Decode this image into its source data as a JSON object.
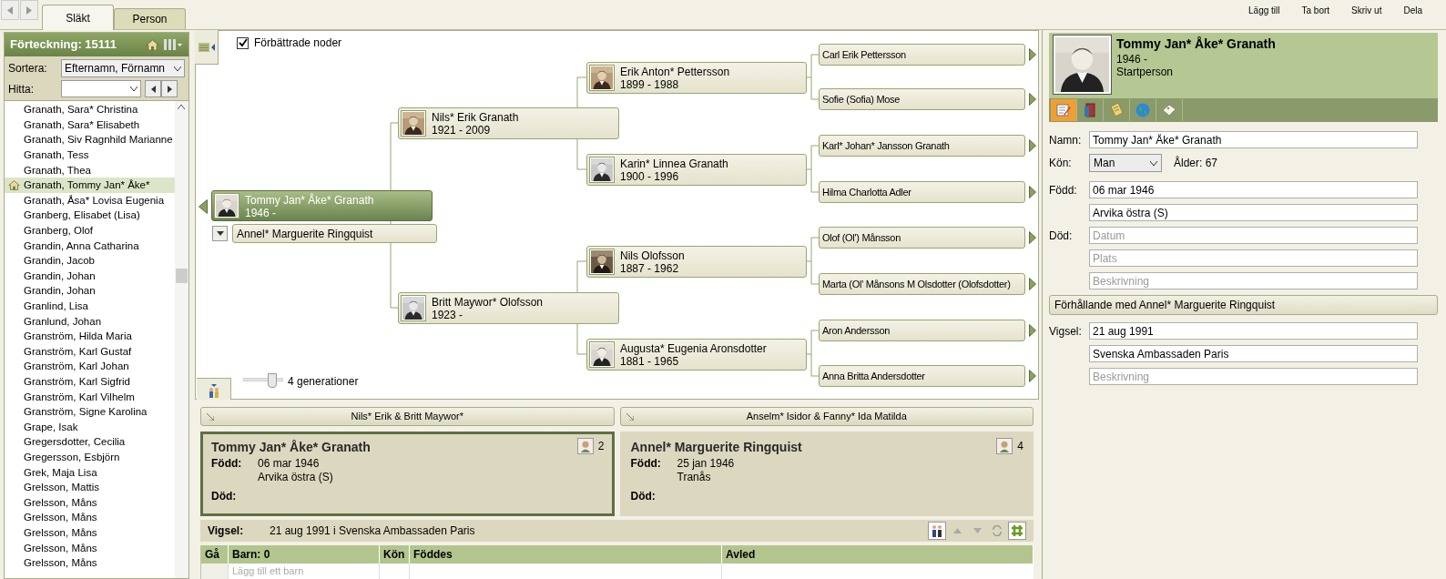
{
  "tabs": [
    {
      "label": "Släkt",
      "selected": true
    },
    {
      "label": "Person",
      "selected": false
    }
  ],
  "toolbar": [
    "Lägg till",
    "Ta bort",
    "Skriv ut",
    "Dela"
  ],
  "index": {
    "title": "Förteckning: 15111",
    "sort_label": "Sortera:",
    "sort_value": "Efternamn, Förnamn",
    "find_label": "Hitta:",
    "items": [
      {
        "name": "Granath, Sara* Christina",
        "selected": false
      },
      {
        "name": "Granath, Sara* Elisabeth",
        "selected": false
      },
      {
        "name": "Granath, Siv Ragnhild Marianne",
        "selected": false
      },
      {
        "name": "Granath, Tess",
        "selected": false
      },
      {
        "name": "Granath, Thea",
        "selected": false
      },
      {
        "name": "Granath, Tommy Jan* Åke*",
        "selected": true
      },
      {
        "name": "Granath, Åsa* Lovisa Eugenia",
        "selected": false
      },
      {
        "name": "Granberg, Elisabet (Lisa)",
        "selected": false
      },
      {
        "name": "Granberg, Olof",
        "selected": false
      },
      {
        "name": "Grandin, Anna Catharina",
        "selected": false
      },
      {
        "name": "Grandin, Jacob",
        "selected": false
      },
      {
        "name": "Grandin, Johan",
        "selected": false
      },
      {
        "name": "Grandin, Johan",
        "selected": false
      },
      {
        "name": "Granlind, Lisa",
        "selected": false
      },
      {
        "name": "Granlund, Johan",
        "selected": false
      },
      {
        "name": "Granström, Hilda Maria",
        "selected": false
      },
      {
        "name": "Granström, Karl Gustaf",
        "selected": false
      },
      {
        "name": "Granström, Karl Johan",
        "selected": false
      },
      {
        "name": "Granström, Karl Sigfrid",
        "selected": false
      },
      {
        "name": "Granström, Karl Vilhelm",
        "selected": false
      },
      {
        "name": "Granström, Signe Karolina",
        "selected": false
      },
      {
        "name": "Grape, Isak",
        "selected": false
      },
      {
        "name": "Gregersdotter, Cecilia",
        "selected": false
      },
      {
        "name": "Gregersson, Esbjörn",
        "selected": false
      },
      {
        "name": "Grek, Maja Lisa",
        "selected": false
      },
      {
        "name": "Grelsson, Mattis",
        "selected": false
      },
      {
        "name": "Grelsson, Måns",
        "selected": false
      },
      {
        "name": "Grelsson, Måns",
        "selected": false
      },
      {
        "name": "Grelsson, Måns",
        "selected": false
      },
      {
        "name": "Grelsson, Måns",
        "selected": false
      },
      {
        "name": "Grelsson, Måns",
        "selected": false
      }
    ]
  },
  "tree": {
    "option": {
      "label": "Förbättrade noder",
      "checked": true
    },
    "root": {
      "name": "Tommy Jan* Åke* Granath",
      "years": "1946 -"
    },
    "spouse": "Annel* Marguerite Ringquist",
    "parents": [
      {
        "name": "Nils* Erik Granath",
        "years": "1921 - 2009"
      },
      {
        "name": "Britt Maywor* Olofsson",
        "years": "1923 -"
      }
    ],
    "grandparents": [
      {
        "name": "Erik Anton* Pettersson",
        "years": "1899 - 1988"
      },
      {
        "name": "Karin* Linnea Granath",
        "years": "1900 - 1996"
      },
      {
        "name": "Nils Olofsson",
        "years": "1887 - 1962"
      },
      {
        "name": "Augusta* Eugenia Aronsdotter",
        "years": "1881 - 1965"
      }
    ],
    "great_grandparents": [
      "Carl Erik Pettersson",
      "Sofie (Sofia) Mose",
      "Karl* Johan* Jansson Granath",
      "Hilma Charlotta Adler",
      "Olof (Ol') Månsson",
      "Marta (Ol' Månsons M Olsdotter (Olofsdotter)",
      "Aron Andersson",
      "Anna Britta Andersdotter"
    ],
    "generations": {
      "label": "4 generationer",
      "level": 0.8
    }
  },
  "family": {
    "parent_buttons": [
      "Nils* Erik & Britt Maywor*",
      "Anselm* Isidor & Fanny* Ida Matilda"
    ],
    "cards": [
      {
        "name": "Tommy Jan* Åke* Granath",
        "selected": true,
        "count": "2",
        "born_label": "Född:",
        "born_date": "06 mar 1946",
        "born_place": "Arvika östra (S)",
        "death_label": "Död:"
      },
      {
        "name": "Annel* Marguerite Ringquist",
        "selected": false,
        "count": "4",
        "born_label": "Född:",
        "born_date": "25 jan 1946",
        "born_place": "Tranås",
        "death_label": "Död:"
      }
    ],
    "marriage": {
      "label": "Vigsel:",
      "text": "21 aug 1991 i Svenska Ambassaden Paris"
    },
    "children_table": {
      "columns": [
        "Gå",
        "Barn: 0",
        "Kön",
        "Föddes",
        "Avled"
      ],
      "placeholder": "Lägg till ett barn"
    }
  },
  "details": {
    "name": "Tommy Jan* Åke* Granath",
    "years": "1946 -",
    "role": "Startperson",
    "tabs": [
      {
        "kind": "edit",
        "selected": true
      },
      {
        "kind": "book",
        "selected": false
      },
      {
        "kind": "notes",
        "selected": false
      },
      {
        "kind": "globe",
        "selected": false
      },
      {
        "kind": "tag",
        "selected": false
      }
    ],
    "name_label": "Namn:",
    "name_value": "Tommy Jan* Åke* Granath",
    "gender_label": "Kön:",
    "gender_value": "Man",
    "age": "Ålder: 67",
    "born_label": "Född:",
    "born_date": "06 mar 1946",
    "born_place": "Arvika östra (S)",
    "death_label": "Död:",
    "death_date_placeholder": "Datum",
    "death_place_placeholder": "Plats",
    "death_desc_placeholder": "Beskrivning",
    "relation": "Förhållande med Annel* Marguerite Ringquist",
    "marriage_label": "Vigsel:",
    "marriage_date": "21 aug 1991",
    "marriage_place": "Svenska Ambassaden Paris",
    "marriage_desc_placeholder": "Beskrivning"
  }
}
